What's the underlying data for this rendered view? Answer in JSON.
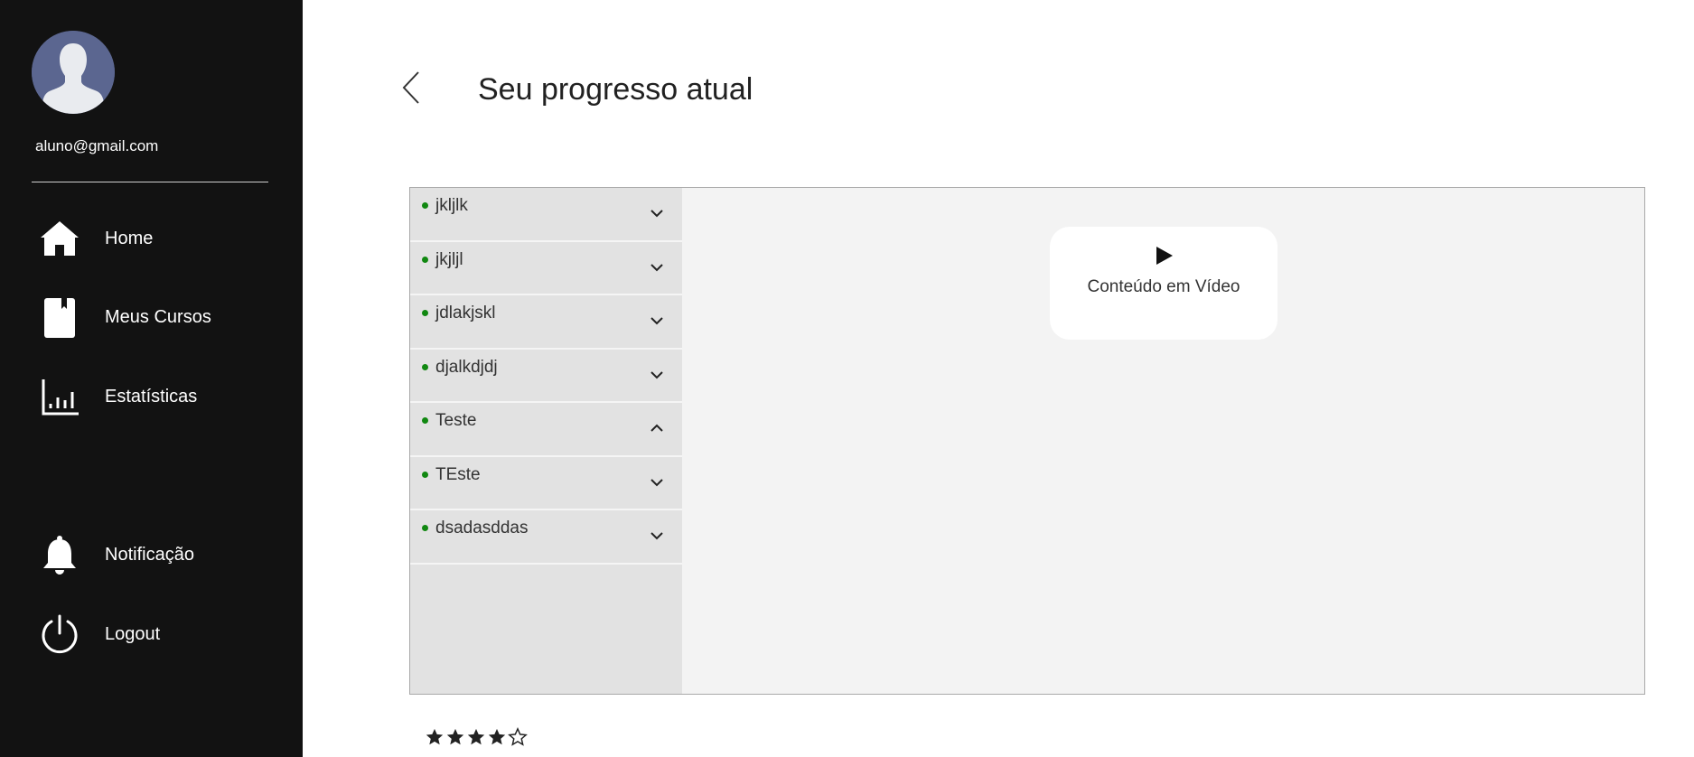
{
  "user": {
    "email": "aluno@gmail.com"
  },
  "sidebar": {
    "items": [
      {
        "label": "Home",
        "icon": "home-icon"
      },
      {
        "label": "Meus Cursos",
        "icon": "book-icon"
      },
      {
        "label": "Estatísticas",
        "icon": "bar-chart-icon"
      }
    ],
    "bottom_items": [
      {
        "label": "Notificação",
        "icon": "bell-icon"
      },
      {
        "label": "Logout",
        "icon": "power-icon"
      }
    ]
  },
  "header": {
    "title": "Seu progresso atual"
  },
  "modules": [
    {
      "name": "jkljlk",
      "expanded": false
    },
    {
      "name": "jkjljl",
      "expanded": false
    },
    {
      "name": "jdlakjskl",
      "expanded": false
    },
    {
      "name": "djalkdjdj",
      "expanded": false
    },
    {
      "name": "Teste",
      "expanded": true
    },
    {
      "name": "TEste",
      "expanded": false
    },
    {
      "name": "dsadasddas",
      "expanded": false
    }
  ],
  "content": {
    "card_label": "Conteúdo em Vídeo",
    "card_icon": "play-icon"
  },
  "rating": {
    "value": 4,
    "max": 5
  },
  "colors": {
    "sidebar_bg": "#121212",
    "status_dot": "#118811",
    "module_bg": "#e2e2e2",
    "panel_bg": "#f3f3f3",
    "avatar_bg": "#5b6690"
  }
}
